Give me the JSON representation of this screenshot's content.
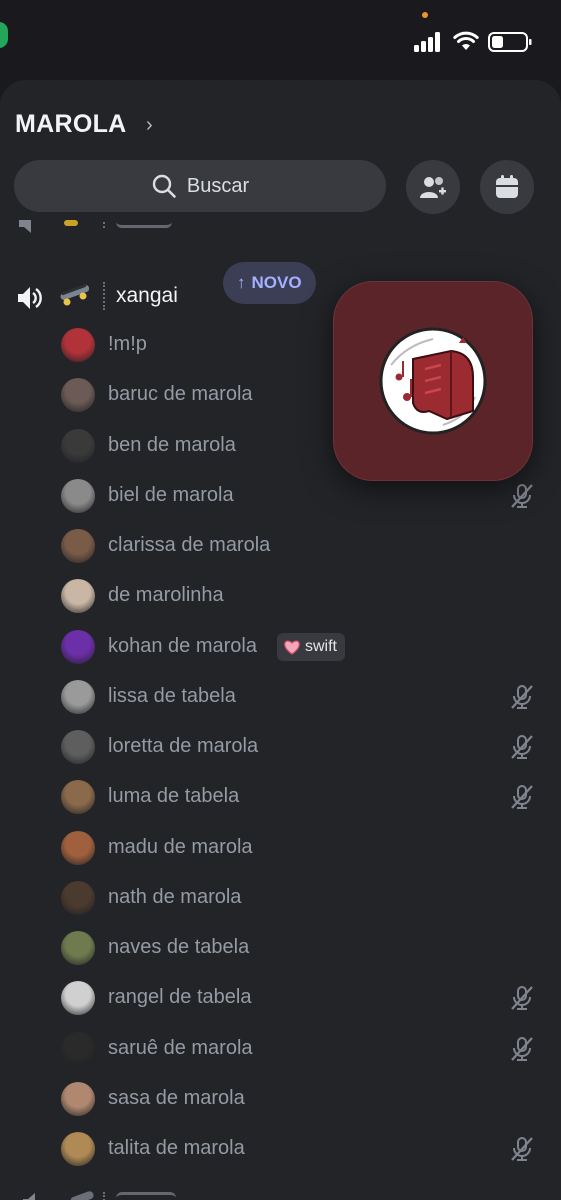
{
  "status_bar": {
    "icons": [
      "signal-icon",
      "wifi-icon",
      "battery-icon"
    ],
    "battery_level": 0.3
  },
  "server": {
    "name": "MAROLA",
    "search_label": "Buscar",
    "actions": [
      "add-member-icon",
      "events-calendar-icon"
    ]
  },
  "channel": {
    "name": "xangai",
    "emoji": "skateboard-icon",
    "new_badge": "NOVO"
  },
  "members": [
    {
      "name": "!m!p",
      "muted": false,
      "avatar_color": "#b2323a"
    },
    {
      "name": "baruc de marola",
      "muted": true,
      "avatar_color": "#6b5a55"
    },
    {
      "name": "ben de marola",
      "muted": true,
      "avatar_color": "#3a3a3a"
    },
    {
      "name": "biel de marola",
      "muted": true,
      "avatar_color": "#8a8a8a"
    },
    {
      "name": "clarissa de marola",
      "muted": false,
      "avatar_color": "#7a5b48"
    },
    {
      "name": "de marolinha",
      "muted": false,
      "avatar_color": "#c9b6a4"
    },
    {
      "name": "kohan de marola",
      "muted": false,
      "avatar_color": "#6b2fa8",
      "tag": "swift"
    },
    {
      "name": "lissa de tabela",
      "muted": true,
      "avatar_color": "#9a9a9a"
    },
    {
      "name": "loretta de marola",
      "muted": true,
      "avatar_color": "#5e5e5e"
    },
    {
      "name": "luma de tabela",
      "muted": true,
      "avatar_color": "#8a6a4a"
    },
    {
      "name": "madu de marola",
      "muted": false,
      "avatar_color": "#a0603e"
    },
    {
      "name": "nath de marola",
      "muted": false,
      "avatar_color": "#4b3a2e"
    },
    {
      "name": "naves de tabela",
      "muted": false,
      "avatar_color": "#6f7a4e"
    },
    {
      "name": "rangel de tabela",
      "muted": true,
      "avatar_color": "#d0d0d0"
    },
    {
      "name": "saruê de marola",
      "muted": true,
      "avatar_color": "#2a2a2a"
    },
    {
      "name": "sasa de marola",
      "muted": false,
      "avatar_color": "#b08870"
    },
    {
      "name": "talita de marola",
      "muted": true,
      "avatar_color": "#b08a55"
    }
  ],
  "colors": {
    "background": "#232428",
    "accent": "#a5b0ff",
    "popup": "#5a2428"
  }
}
